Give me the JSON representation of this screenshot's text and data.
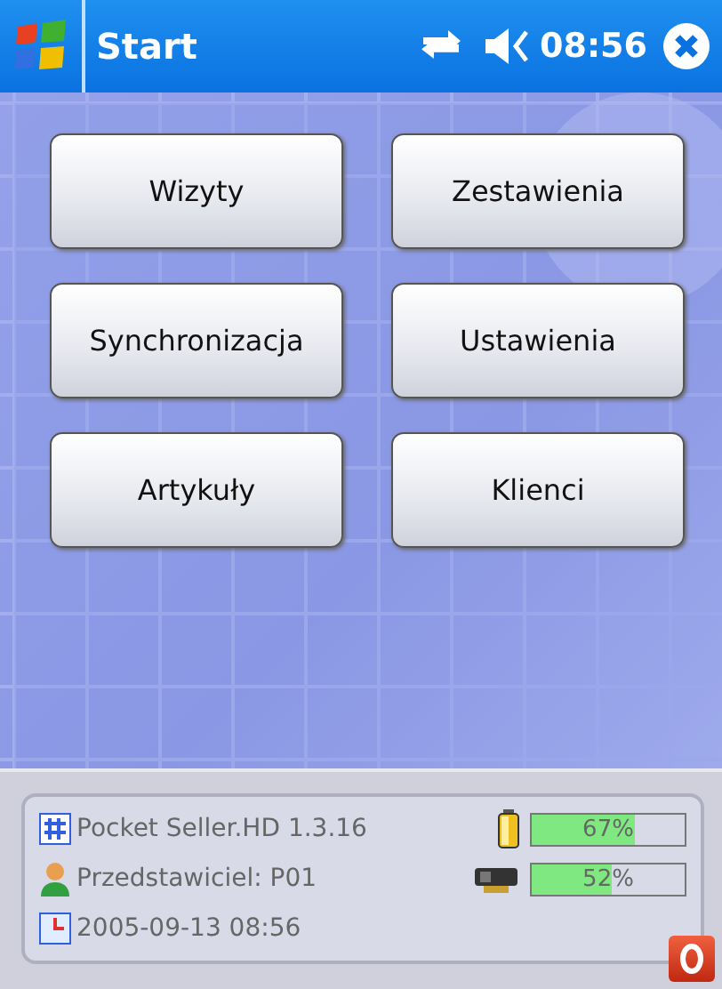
{
  "title_bar": {
    "title": "Start",
    "time": "08:56"
  },
  "buttons": [
    "Wizyty",
    "Zestawienia",
    "Synchronizacja",
    "Ustawienia",
    "Artykuły",
    "Klienci"
  ],
  "status": {
    "app": "Pocket Seller.HD 1.3.16",
    "user": "Przedstawiciel: P01",
    "datetime": "2005-09-13 08:56",
    "meters": [
      {
        "kind": "battery",
        "level": 0.67,
        "reading": "67%"
      },
      {
        "kind": "memory",
        "level": 0.52,
        "reading": "52%"
      }
    ]
  }
}
